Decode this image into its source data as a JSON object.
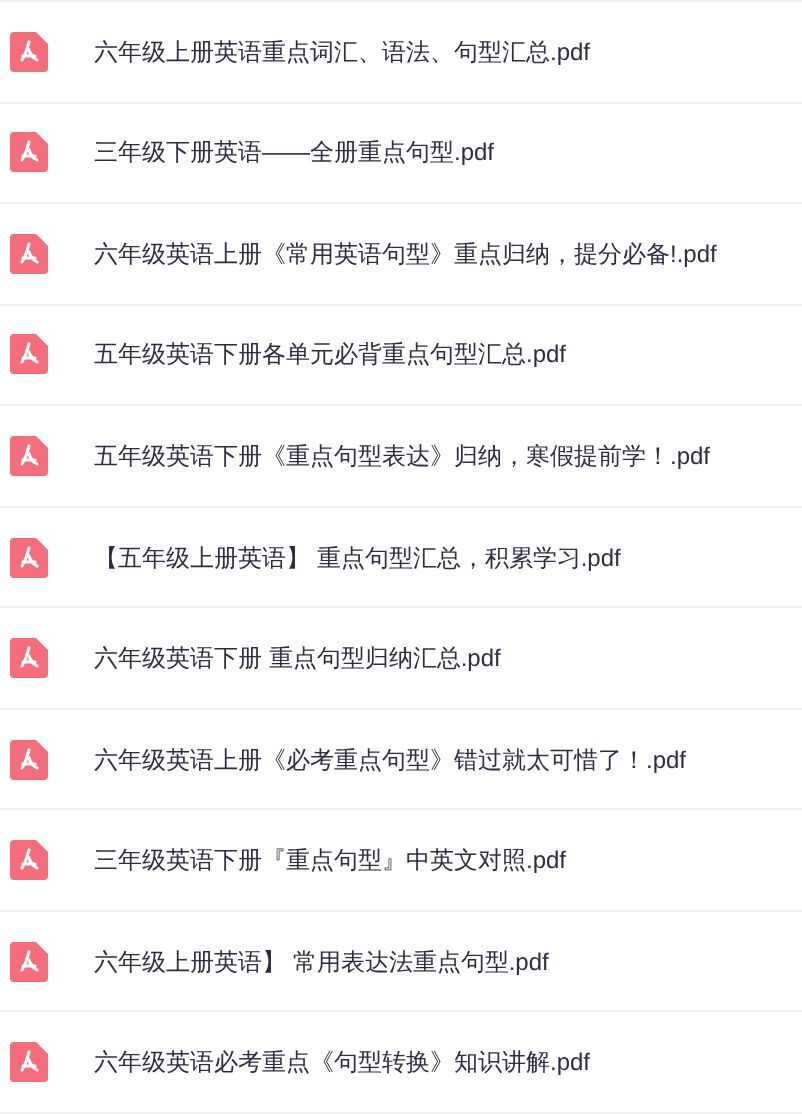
{
  "files": [
    {
      "name": "六年级上册英语重点词汇、语法、句型汇总.pdf"
    },
    {
      "name": "三年级下册英语——全册重点句型.pdf"
    },
    {
      "name": "六年级英语上册《常用英语句型》重点归纳，提分必备!.pdf"
    },
    {
      "name": "五年级英语下册各单元必背重点句型汇总.pdf"
    },
    {
      "name": "五年级英语下册《重点句型表达》归纳，寒假提前学！.pdf"
    },
    {
      "name": "【五年级上册英语】 重点句型汇总，积累学习.pdf"
    },
    {
      "name": "六年级英语下册 重点句型归纳汇总.pdf"
    },
    {
      "name": "六年级英语上册《必考重点句型》错过就太可惜了！.pdf"
    },
    {
      "name": "三年级英语下册『重点句型』中英文对照.pdf"
    },
    {
      "name": "六年级上册英语】 常用表达法重点句型.pdf"
    },
    {
      "name": "六年级英语必考重点《句型转换》知识讲解.pdf"
    }
  ]
}
